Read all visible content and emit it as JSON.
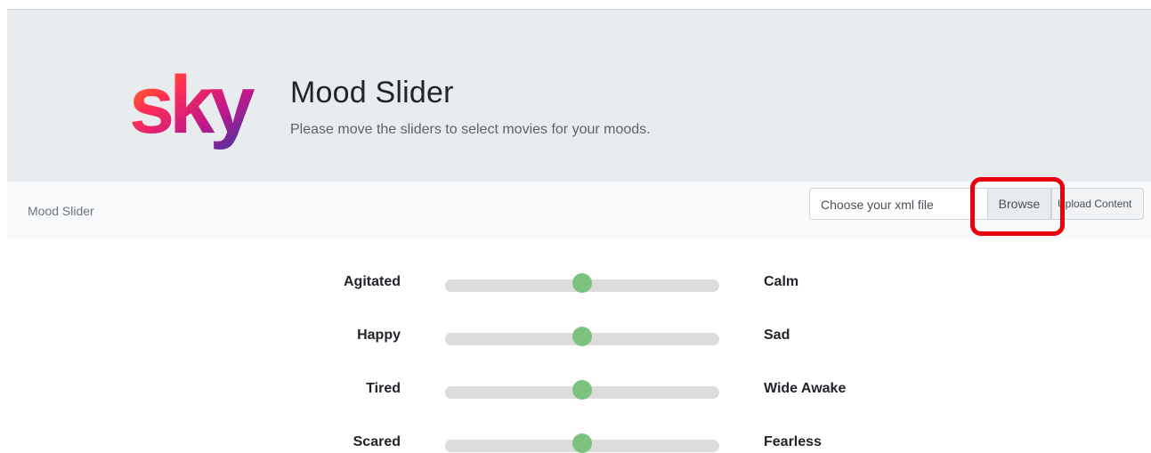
{
  "header": {
    "logo_text": "sky",
    "title": "Mood Slider",
    "subtitle": "Please move the sliders to select movies for your moods."
  },
  "navbar": {
    "brand": "Mood Slider",
    "file_placeholder": "Choose your xml file",
    "browse_label": "Browse",
    "upload_label": "Upload Content"
  },
  "sliders": [
    {
      "left": "Agitated",
      "right": "Calm",
      "value": 0.5
    },
    {
      "left": "Happy",
      "right": "Sad",
      "value": 0.5
    },
    {
      "left": "Tired",
      "right": "Wide Awake",
      "value": 0.5
    },
    {
      "left": "Scared",
      "right": "Fearless",
      "value": 0.5
    }
  ],
  "colors": {
    "thumb": "#7cc37f",
    "track": "#dcdcdc",
    "highlight": "#e8000d"
  }
}
